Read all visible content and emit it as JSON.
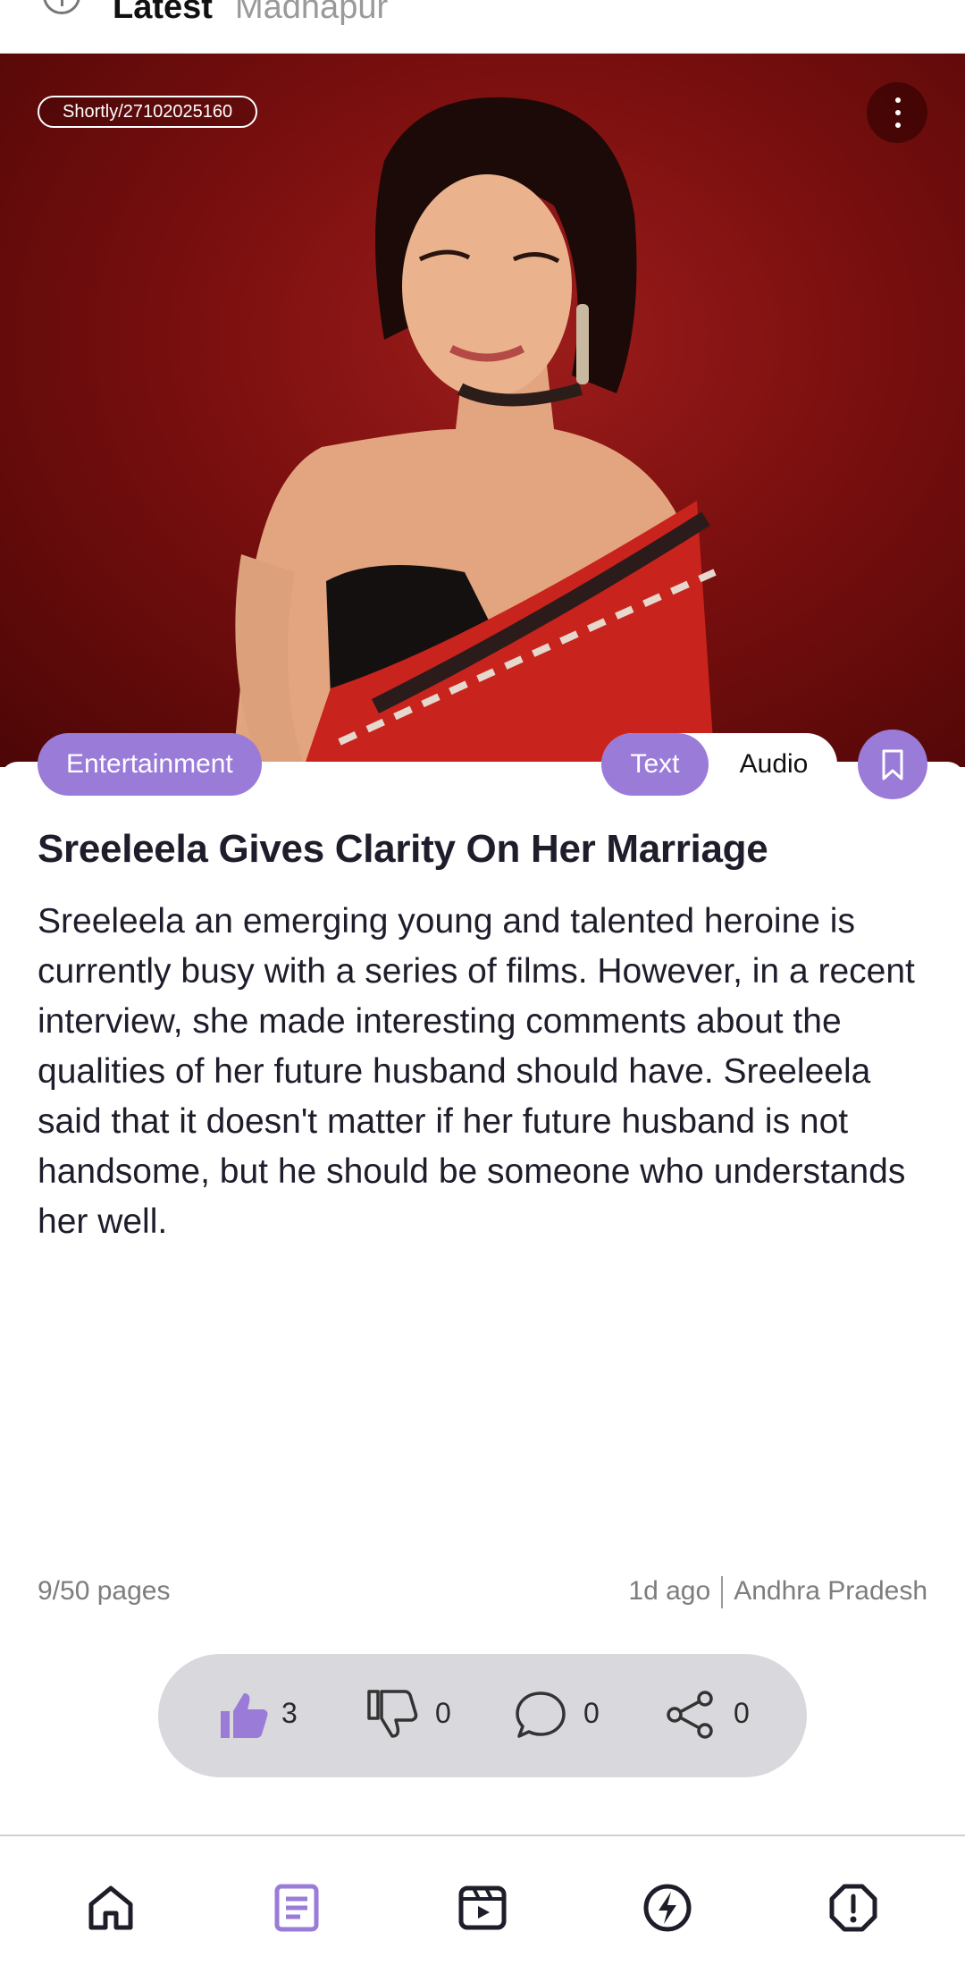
{
  "top_tabs": {
    "active": "Latest",
    "inactive": "Madhapur"
  },
  "hero": {
    "badge": "Shortly/27102025160"
  },
  "category": "Entertainment",
  "view_toggle": {
    "text": "Text",
    "audio": "Audio"
  },
  "article": {
    "title": "Sreeleela Gives Clarity On Her Marriage",
    "body": "Sreeleela an emerging young and talented heroine is currently busy with a series of films. However, in a recent interview, she made interesting comments about the qualities of her future husband should have. Sreeleela said that it doesn't matter if her future husband is not handsome, but he should be someone who understands her well."
  },
  "footer_meta": {
    "pages": "9/50 pages",
    "time": "1d ago",
    "location": "Andhra Pradesh"
  },
  "actions": {
    "likes": "3",
    "dislikes": "0",
    "comments": "0",
    "shares": "0"
  },
  "colors": {
    "accent": "#9a7bd8",
    "action_bar": "#d9d8dc"
  },
  "bottom_nav": [
    "home-icon",
    "article-icon",
    "video-icon",
    "flash-icon",
    "alert-icon"
  ]
}
